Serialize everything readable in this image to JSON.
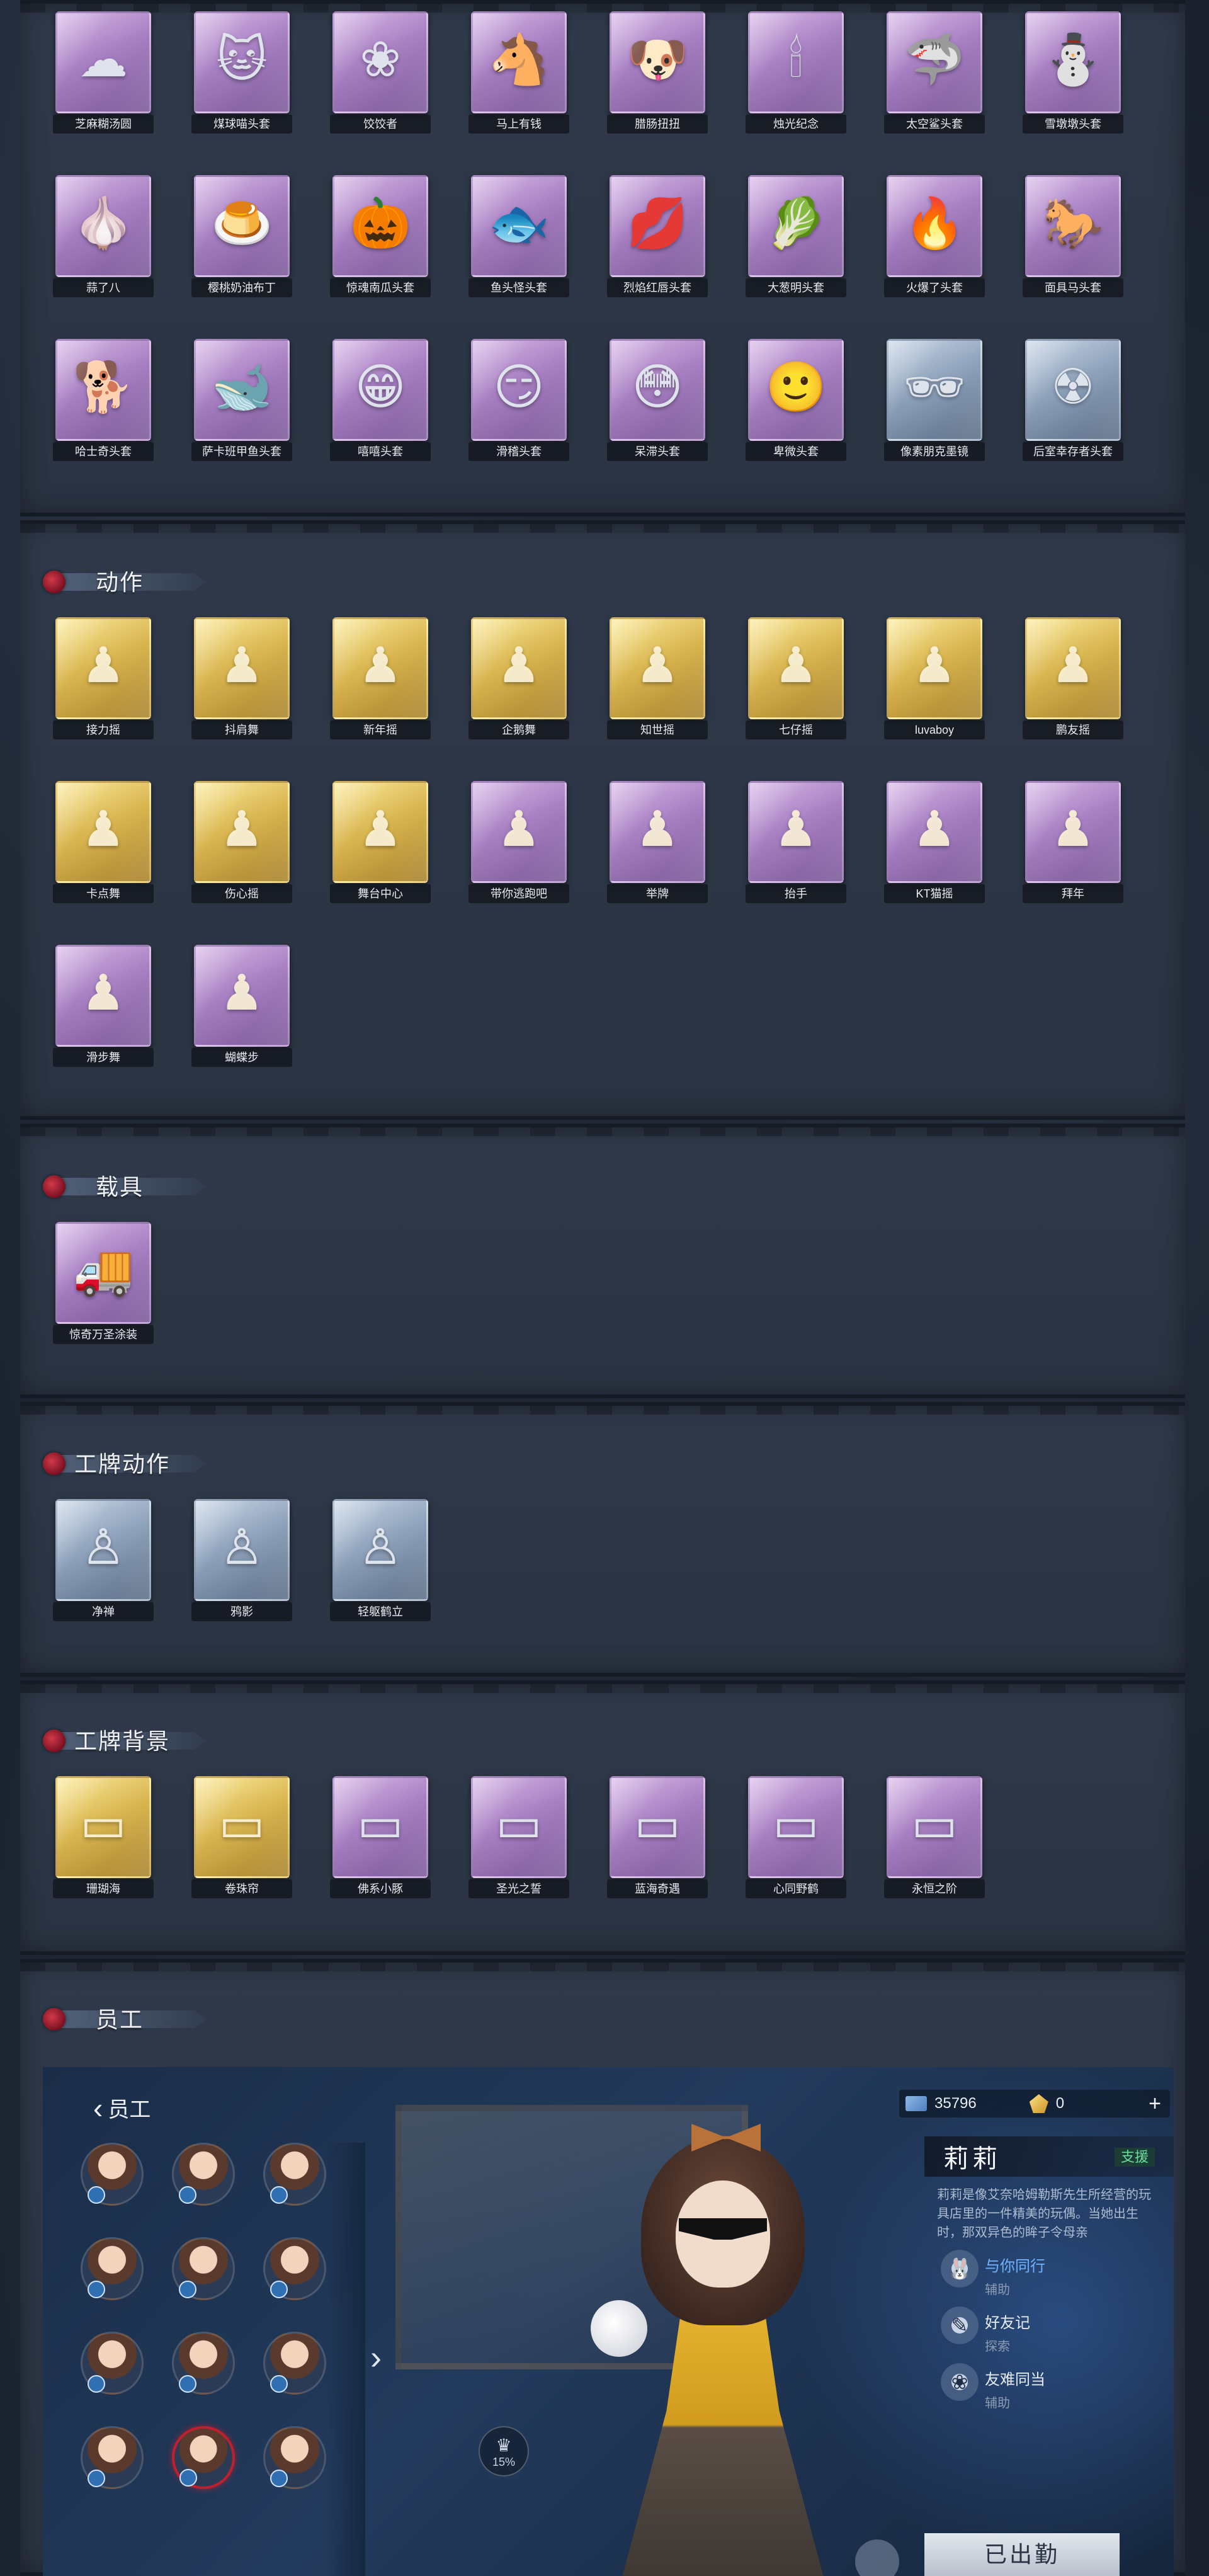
{
  "sections": {
    "heads": {
      "title": "",
      "items": [
        {
          "label": "芝麻糊汤圆",
          "icon": "☁",
          "tone": "purple"
        },
        {
          "label": "煤球喵头套",
          "icon": "🐱",
          "tone": "purple"
        },
        {
          "label": "饺饺者",
          "icon": "❀",
          "tone": "purple"
        },
        {
          "label": "马上有钱",
          "icon": "🐴",
          "tone": "purple"
        },
        {
          "label": "腊肠扭扭",
          "icon": "🐶",
          "tone": "purple"
        },
        {
          "label": "烛光纪念",
          "icon": "🕯",
          "tone": "purple"
        },
        {
          "label": "太空鲨头套",
          "icon": "🦈",
          "tone": "purple"
        },
        {
          "label": "雪墩墩头套",
          "icon": "⛄",
          "tone": "purple"
        },
        {
          "label": "蒜了八",
          "icon": "🧄",
          "tone": "purple"
        },
        {
          "label": "樱桃奶油布丁",
          "icon": "🍮",
          "tone": "purple"
        },
        {
          "label": "惊魂南瓜头套",
          "icon": "🎃",
          "tone": "purple"
        },
        {
          "label": "鱼头怪头套",
          "icon": "🐟",
          "tone": "purple"
        },
        {
          "label": "烈焰红唇头套",
          "icon": "💋",
          "tone": "purple"
        },
        {
          "label": "大葱明头套",
          "icon": "🥬",
          "tone": "purple"
        },
        {
          "label": "火爆了头套",
          "icon": "🔥",
          "tone": "purple"
        },
        {
          "label": "面具马头套",
          "icon": "🐎",
          "tone": "purple"
        },
        {
          "label": "哈士奇头套",
          "icon": "🐕",
          "tone": "purple"
        },
        {
          "label": "萨卡班甲鱼头套",
          "icon": "🐋",
          "tone": "purple"
        },
        {
          "label": "嘻嘻头套",
          "icon": "😁",
          "tone": "purple"
        },
        {
          "label": "滑稽头套",
          "icon": "😏",
          "tone": "purple"
        },
        {
          "label": "呆滞头套",
          "icon": "😳",
          "tone": "purple"
        },
        {
          "label": "卑微头套",
          "icon": "🙂",
          "tone": "purple"
        },
        {
          "label": "像素朋克墨镜",
          "icon": "🕶",
          "tone": "blue"
        },
        {
          "label": "后室幸存者头套",
          "icon": "☢",
          "tone": "blue"
        }
      ]
    },
    "motions": {
      "title": "动作",
      "items": [
        {
          "label": "接力摇",
          "icon": "♟",
          "tone": "gold"
        },
        {
          "label": "抖肩舞",
          "icon": "♟",
          "tone": "gold"
        },
        {
          "label": "新年摇",
          "icon": "♟",
          "tone": "gold"
        },
        {
          "label": "企鹅舞",
          "icon": "♟",
          "tone": "gold"
        },
        {
          "label": "知世摇",
          "icon": "♟",
          "tone": "gold"
        },
        {
          "label": "七仔摇",
          "icon": "♟",
          "tone": "gold"
        },
        {
          "label": "luvaboy",
          "icon": "♟",
          "tone": "gold"
        },
        {
          "label": "鹏友摇",
          "icon": "♟",
          "tone": "gold"
        },
        {
          "label": "卡点舞",
          "icon": "♟",
          "tone": "gold"
        },
        {
          "label": "伤心摇",
          "icon": "♟",
          "tone": "gold"
        },
        {
          "label": "舞台中心",
          "icon": "♟",
          "tone": "gold"
        },
        {
          "label": "带你逃跑吧",
          "icon": "♟",
          "tone": "purple"
        },
        {
          "label": "举牌",
          "icon": "♟",
          "tone": "purple"
        },
        {
          "label": "抬手",
          "icon": "♟",
          "tone": "purple"
        },
        {
          "label": "KT猫摇",
          "icon": "♟",
          "tone": "purple"
        },
        {
          "label": "拜年",
          "icon": "♟",
          "tone": "purple"
        },
        {
          "label": "滑步舞",
          "icon": "♟",
          "tone": "purple"
        },
        {
          "label": "蝴蝶步",
          "icon": "♟",
          "tone": "purple"
        }
      ]
    },
    "vehicles": {
      "title": "载具",
      "items": [
        {
          "label": "惊奇万圣涂装",
          "icon": "🚚",
          "tone": "purple"
        }
      ]
    },
    "badge_actions": {
      "title": "工牌动作",
      "items": [
        {
          "label": "净禅",
          "icon": "♙",
          "tone": "blue"
        },
        {
          "label": "鸦影",
          "icon": "♙",
          "tone": "blue"
        },
        {
          "label": "轻躯鹤立",
          "icon": "♙",
          "tone": "blue"
        }
      ]
    },
    "badge_backgrounds": {
      "title": "工牌背景",
      "items": [
        {
          "label": "珊瑚海",
          "icon": "▭",
          "tone": "gold"
        },
        {
          "label": "卷珠帘",
          "icon": "▭",
          "tone": "gold"
        },
        {
          "label": "佛系小豚",
          "icon": "▭",
          "tone": "purple"
        },
        {
          "label": "圣光之誓",
          "icon": "▭",
          "tone": "purple"
        },
        {
          "label": "蓝海奇遇",
          "icon": "▭",
          "tone": "purple"
        },
        {
          "label": "心同野鹤",
          "icon": "▭",
          "tone": "purple"
        },
        {
          "label": "永恒之阶",
          "icon": "▭",
          "tone": "purple"
        }
      ]
    },
    "staff": {
      "title": "员工"
    }
  },
  "employee_screen": {
    "back_label": "员工",
    "currency_notes": "35796",
    "currency_gold": "0",
    "character_name": "莉莉",
    "character_tag": "支援",
    "description": "莉莉是像艾奈哈姆勒斯先生所经营的玩具店里的一件精美的玩偶。当她出生时，那双异色的眸子令母亲",
    "skills": [
      {
        "name": "与你同行",
        "type": "辅助",
        "highlight": true,
        "icon": "🐰"
      },
      {
        "name": "好友记",
        "type": "探索",
        "highlight": false,
        "icon": "✎"
      },
      {
        "name": "友难同当",
        "type": "辅助",
        "highlight": false,
        "icon": "❀"
      }
    ],
    "level_text": "15%",
    "dispatch_label": "已出勤"
  }
}
